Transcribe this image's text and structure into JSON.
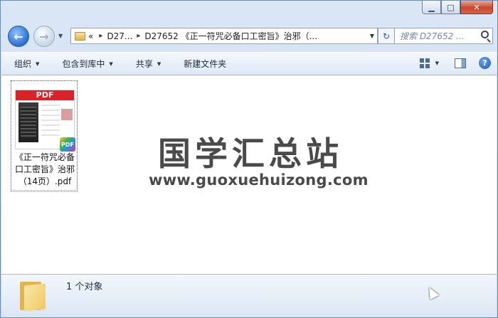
{
  "window": {
    "minimize_icon": "minimize-icon",
    "maximize_icon": "maximize-icon",
    "close_icon": "close-icon",
    "close_color": "#c9452d"
  },
  "nav": {
    "address_overflow": "«",
    "address_crumb_1": "D27...",
    "address_crumb_2": "D27652 《正一符咒必备口工密旨》治邪（...",
    "search_placeholder": "搜索 D27652 ..."
  },
  "toolbar": {
    "organize": "组织",
    "include_library": "包含到库中",
    "share": "共享",
    "new_folder": "新建文件夹",
    "help": "?"
  },
  "file": {
    "thumb_header": "PDF",
    "badge": "PDF",
    "name_line1": "《正一符咒必备",
    "name_line2": "口工密旨》治邪",
    "name_line3": "（14页）.pdf"
  },
  "watermark": {
    "title": "国学汇总站",
    "url": "www.guoxuehuizong.com"
  },
  "details": {
    "count": "1 个对象"
  }
}
